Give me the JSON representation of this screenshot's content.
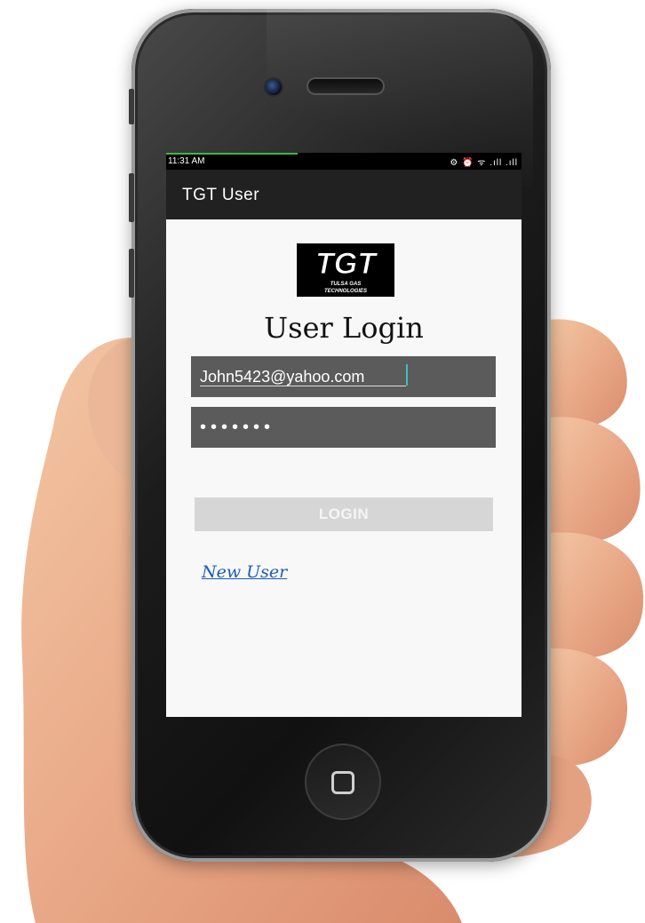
{
  "status_bar": {
    "time": "11:31 AM",
    "icons": "⚙ ⏰ ᯤ .ıll .ıll"
  },
  "app_bar": {
    "title": "TGT User"
  },
  "logo": {
    "text": "TGT",
    "subtitle_line1": "TULSA GAS",
    "subtitle_line2": "TECHNOLOGIES"
  },
  "login": {
    "heading": "User Login",
    "email_value": "John5423@yahoo.com",
    "password_value": "•••••••",
    "button_label": "LOGIN",
    "new_user_link": "New User"
  },
  "colors": {
    "action_bar": "#212121",
    "input_bg": "#5b5b5b",
    "button_bg": "#d6d6d6",
    "link": "#1a5db5"
  }
}
